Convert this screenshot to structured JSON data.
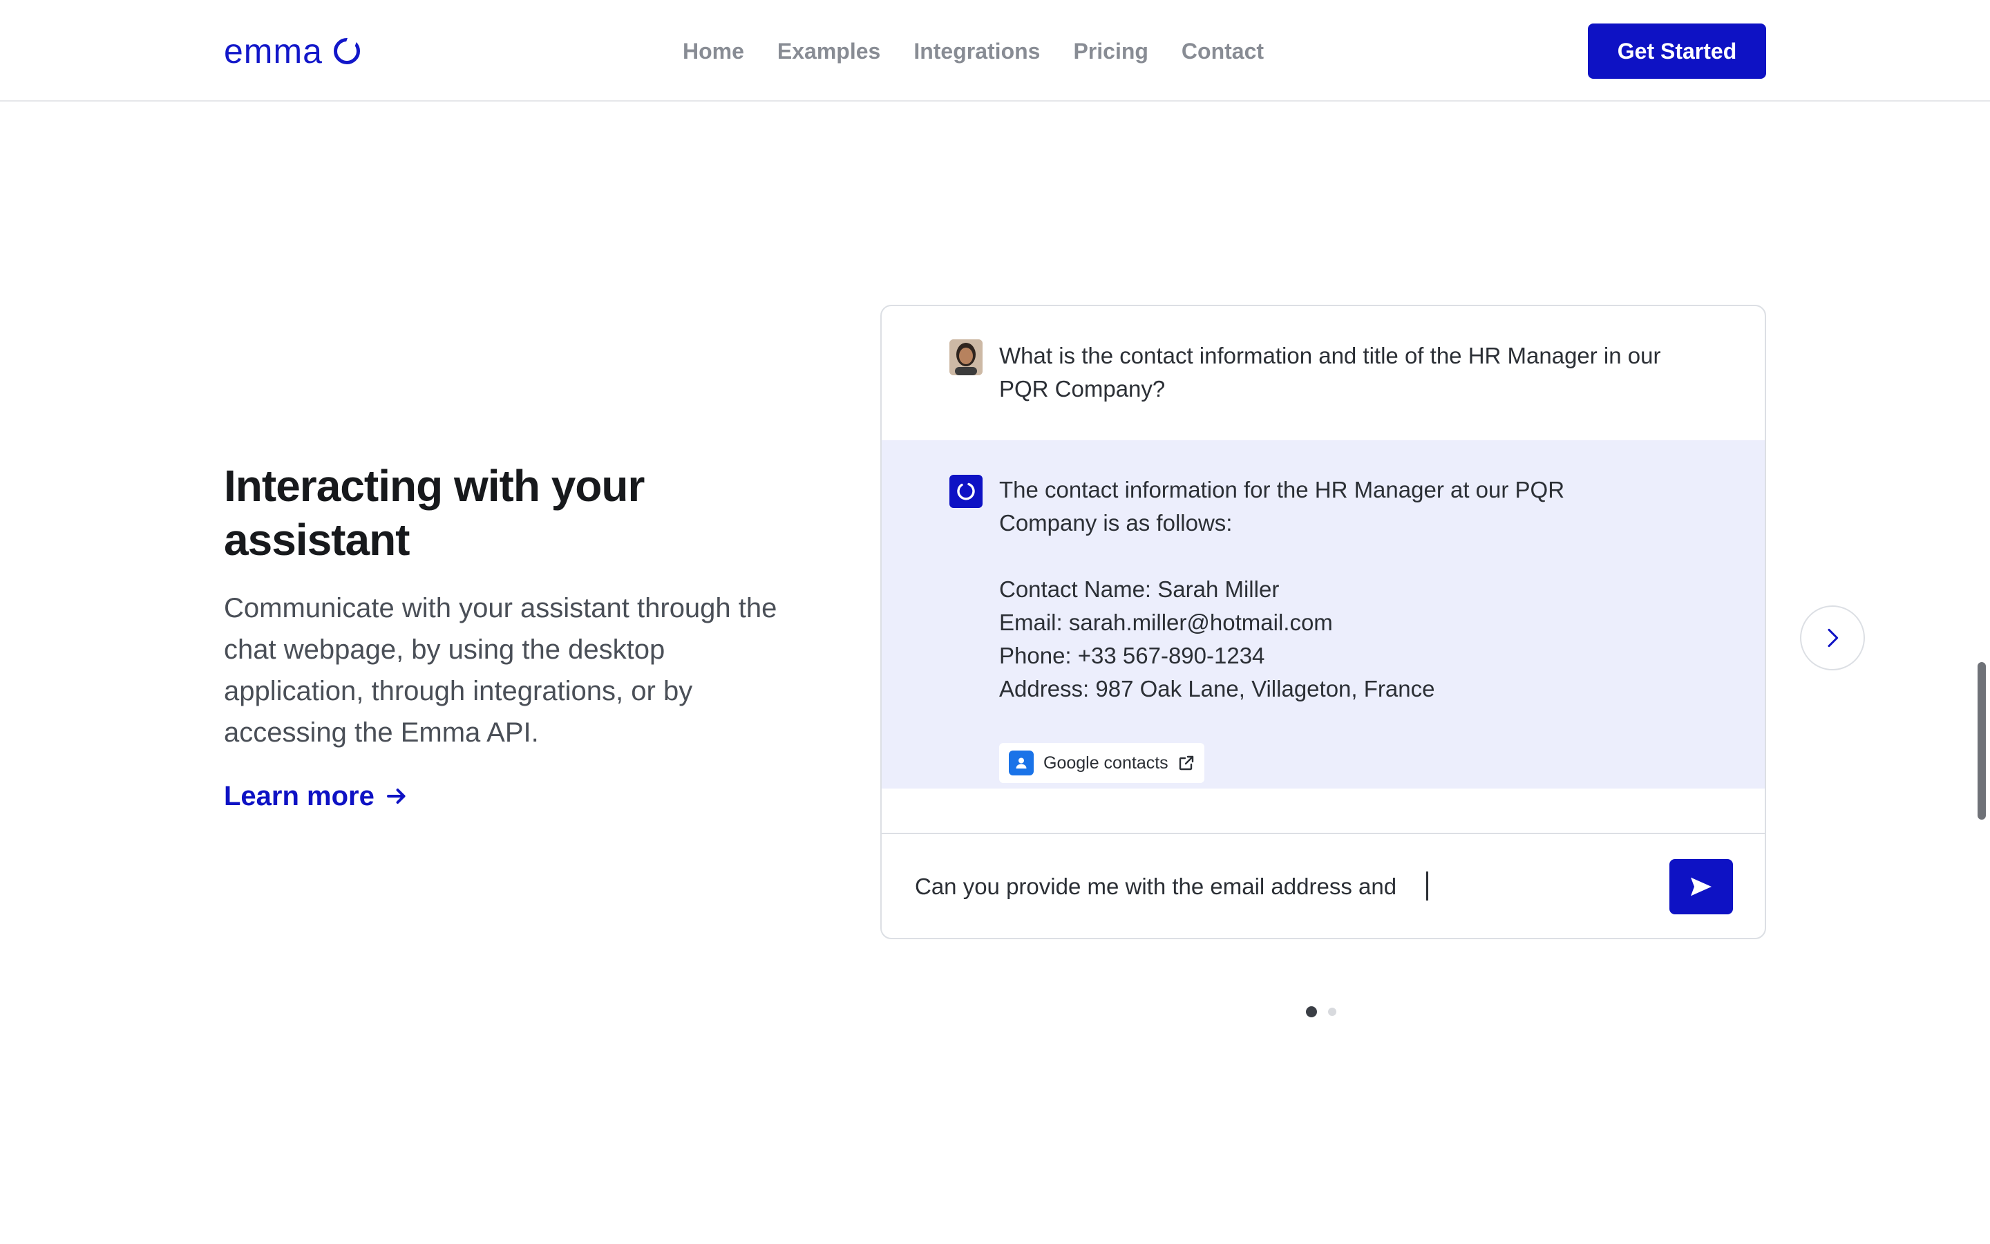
{
  "header": {
    "logo_text": "emma",
    "nav": [
      "Home",
      "Examples",
      "Integrations",
      "Pricing",
      "Contact"
    ],
    "cta_label": "Get Started"
  },
  "hero": {
    "title": "Interacting with your assistant",
    "description": "Communicate with your assistant through the chat webpage, by using the desktop application, through integrations, or by accessing the Emma API.",
    "learn_more": "Learn more"
  },
  "chat": {
    "user_message": "What is the contact information and title of the HR Manager in our PQR Company?",
    "bot_intro": "The contact information for the HR Manager at our PQR Company is as follows:",
    "bot_lines": [
      "Contact Name: Sarah Miller",
      "Email: sarah.miller@hotmail.com",
      "Phone: +33 567-890-1234",
      "Address: 987 Oak Lane, Villageton, France"
    ],
    "source_label": "Google contacts",
    "composer_value": "Can you provide me with the email address and "
  },
  "carousel": {
    "active_index": 0,
    "total": 2
  },
  "colors": {
    "brand": "#0e12c4",
    "bot_bubble": "#eceefc",
    "nav_text": "#888c94"
  },
  "icons": {
    "next": "chevron-right-icon",
    "send": "send-icon",
    "source": "contacts-icon",
    "external": "external-link-icon"
  }
}
